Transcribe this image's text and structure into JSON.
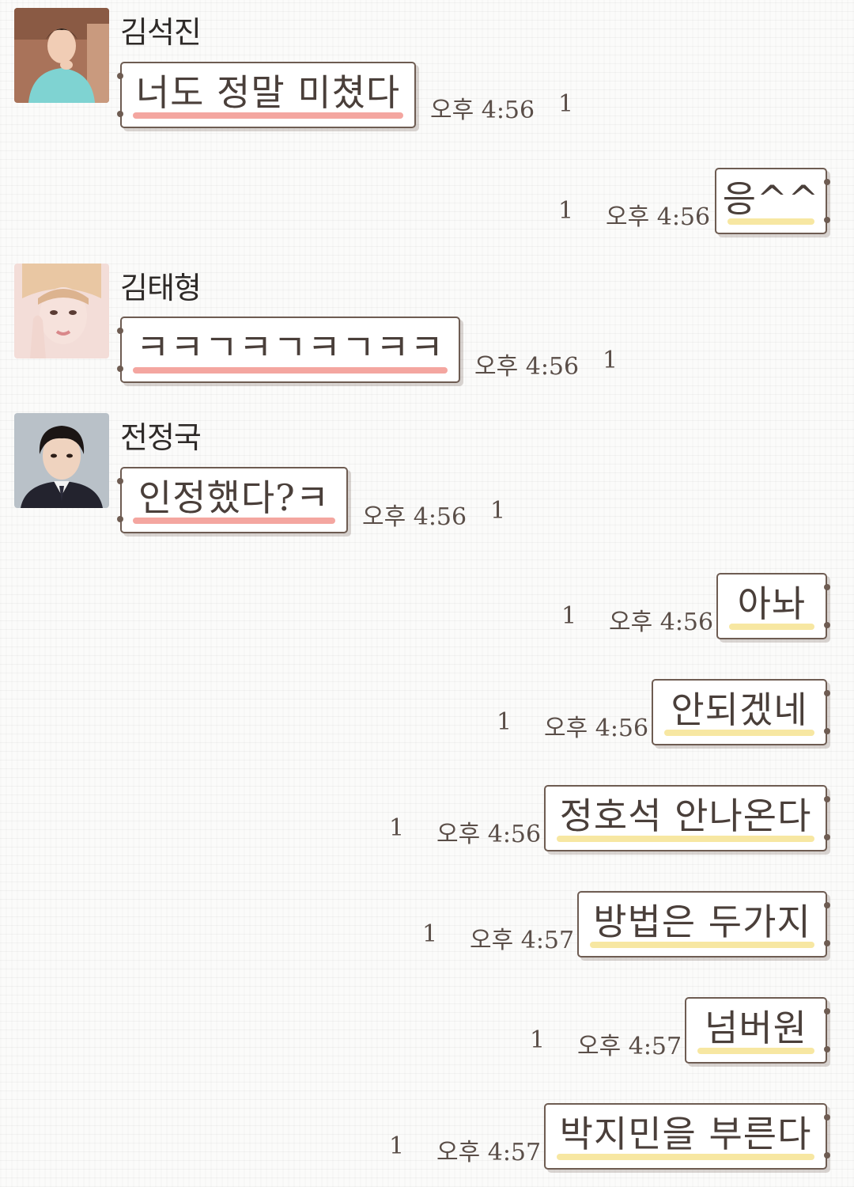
{
  "messages": [
    {
      "sender": "김석진",
      "avatar": "jin-avatar",
      "text": "너도 정말 미쳤다",
      "time": "오후 4:56",
      "unread": "1"
    },
    {
      "text": "응^^",
      "time": "오후 4:56",
      "unread": "1"
    },
    {
      "sender": "김태형",
      "avatar": "taehyung-avatar",
      "text": "ㅋㅋㄱㅋㄱㅋㄱㅋㅋ",
      "time": "오후 4:56",
      "unread": "1"
    },
    {
      "sender": "전정국",
      "avatar": "jungkook-avatar",
      "text": "인정했다?ㅋ",
      "time": "오후 4:56",
      "unread": "1"
    },
    {
      "text": "아놔",
      "time": "오후 4:56",
      "unread": "1"
    },
    {
      "text": "안되겠네",
      "time": "오후 4:56",
      "unread": "1"
    },
    {
      "text": "정호석 안나온다",
      "time": "오후 4:56",
      "unread": "1"
    },
    {
      "text": "방법은 두가지",
      "time": "오후 4:57",
      "unread": "1"
    },
    {
      "text": "넘버원",
      "time": "오후 4:57",
      "unread": "1"
    },
    {
      "text": "박지민을 부른다",
      "time": "오후 4:57",
      "unread": "1"
    }
  ],
  "colors": {
    "incoming_highlight": "#f4a6a0",
    "outgoing_highlight": "#f7e7a2",
    "bubble_border": "#6e5c52"
  }
}
